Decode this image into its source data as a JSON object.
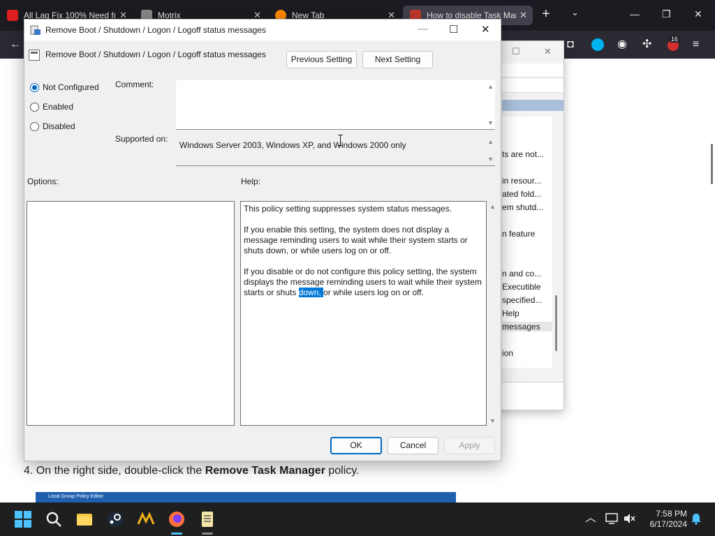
{
  "browser": {
    "tabs": [
      {
        "title": "All Lag Fix 100% Need fo",
        "close": "✕",
        "favicon_color": "#e02020"
      },
      {
        "title": "Motrix",
        "close": "✕",
        "favicon_color": "#8a8a8a"
      },
      {
        "title": "New Tab",
        "close": "✕",
        "favicon_color": "#ff8a00"
      },
      {
        "title": "How to disable Task Mar",
        "close": "✕",
        "favicon_color": "#c0392b"
      }
    ],
    "new_tab": "+",
    "tab_list": "⌄",
    "window_controls": {
      "minimize": "—",
      "maximize": "❐",
      "close": "✕"
    },
    "nav": {
      "back": "←",
      "pocket": "◘",
      "account": "◉",
      "extensions": "✣",
      "menu": "≡",
      "notification_count": "16"
    }
  },
  "article": {
    "step_prefix": "4. On the right side, double-click the ",
    "step_bold": "Remove Task Manager",
    "step_suffix": " policy.",
    "embed_caption": "Local Group Policy Editor"
  },
  "gpe_window": {
    "controls": {
      "maximize": "☐",
      "close": "✕"
    },
    "items": [
      {
        "label": "ts are not..."
      },
      {
        "label": "in resour..."
      },
      {
        "label": "ated fold..."
      },
      {
        "label": "em shutd..."
      },
      {
        "label": "n feature"
      },
      {
        "label": "n and co..."
      },
      {
        "label": "Executible"
      },
      {
        "label": "specified..."
      },
      {
        "label": "Help"
      },
      {
        "label": "messages"
      },
      {
        "label": "ion"
      }
    ]
  },
  "dialog": {
    "title": "Remove Boot / Shutdown / Logon / Logoff status messages",
    "controls": {
      "minimize": "—",
      "maximize": "☐",
      "close": "✕"
    },
    "policy_name": "Remove Boot / Shutdown / Logon / Logoff status messages",
    "previous_setting": "Previous Setting",
    "next_setting": "Next Setting",
    "radios": [
      {
        "label": "Not Configured",
        "checked": true
      },
      {
        "label": "Enabled",
        "checked": false
      },
      {
        "label": "Disabled",
        "checked": false
      }
    ],
    "comment_label": "Comment:",
    "supported_label": "Supported on:",
    "supported_value": "Windows Server 2003, Windows XP, and Windows 2000 only",
    "options_label": "Options:",
    "help_label": "Help:",
    "help": {
      "p1": "This policy setting suppresses system status messages.",
      "p2": "If you enable this setting, the system does not display a message reminding users to wait while their system starts or shuts down, or while users log on or off.",
      "p3_before": "If you disable or do not configure this policy setting, the system displays the message reminding users to wait while their system starts or shuts ",
      "p3_selected": "down, ",
      "p3_after": "or while users log on or off."
    },
    "ok": "OK",
    "cancel": "Cancel",
    "apply": "Apply",
    "scroll_up": "▲",
    "scroll_down": "▼"
  },
  "taskbar": {
    "tray_chevron": "︿",
    "time": "7:58 PM",
    "date": "6/17/2024",
    "accent": "#4cc2ff"
  }
}
